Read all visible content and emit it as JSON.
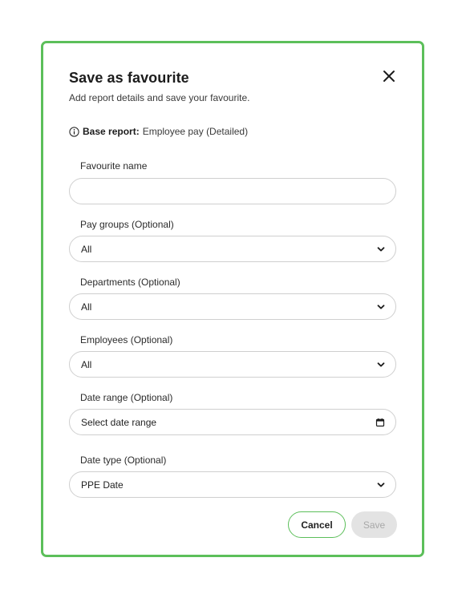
{
  "dialog": {
    "title": "Save as favourite",
    "subtitle": "Add report details and save your favourite.",
    "close_icon": "close-icon",
    "base_report_label": "Base report:",
    "base_report_value": "Employee pay (Detailed)"
  },
  "fields": {
    "favourite_name": {
      "label": "Favourite name",
      "value": ""
    },
    "pay_groups": {
      "label": "Pay groups (Optional)",
      "value": "All"
    },
    "departments": {
      "label": "Departments (Optional)",
      "value": "All"
    },
    "employees": {
      "label": "Employees (Optional)",
      "value": "All"
    },
    "date_range": {
      "label": "Date range (Optional)",
      "placeholder": "Select date range"
    },
    "date_type": {
      "label": "Date type (Optional)",
      "value": "PPE Date"
    }
  },
  "actions": {
    "cancel_label": "Cancel",
    "save_label": "Save"
  },
  "colors": {
    "accent": "#5cbf5a",
    "border": "#cfcfcf",
    "disabled_bg": "#e3e3e3"
  }
}
